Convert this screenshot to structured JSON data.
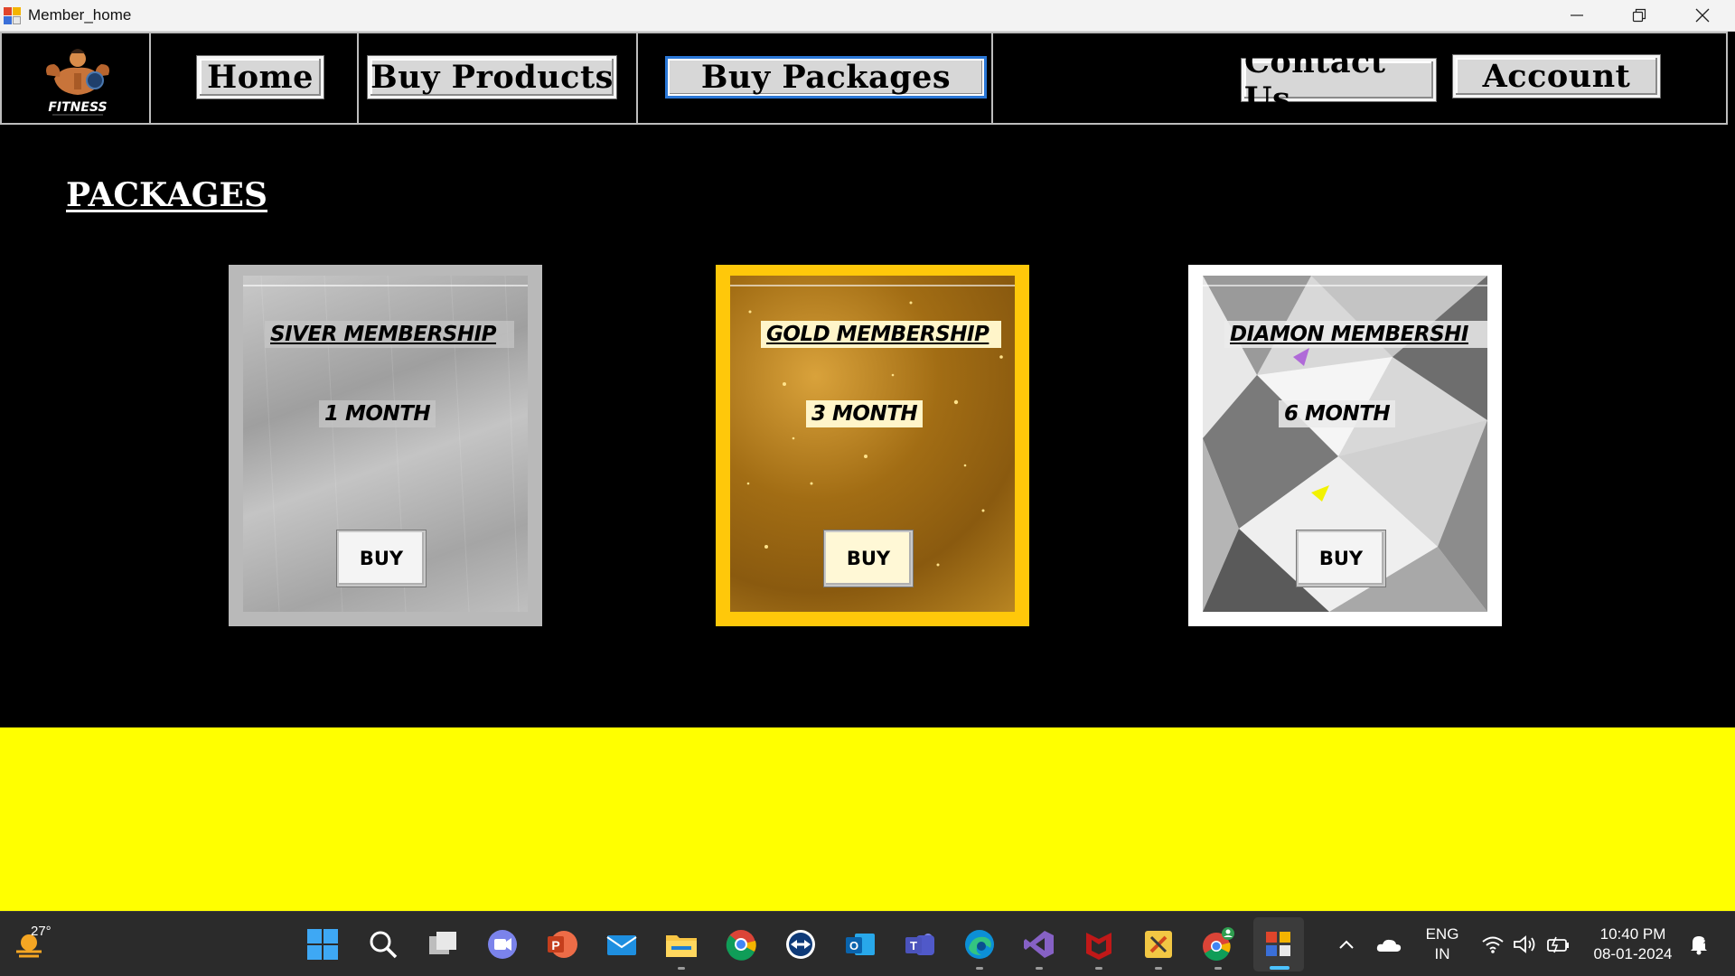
{
  "window": {
    "title": "Member_home",
    "controls": [
      "minimize",
      "restore",
      "close"
    ]
  },
  "nav": {
    "logo_text": "FITNESS",
    "home": "Home",
    "buy_products": "Buy Products",
    "buy_packages": "Buy Packages",
    "contact_us": "Contact Us",
    "account": "Account",
    "active": "Buy Packages"
  },
  "content": {
    "heading": "PACKAGES",
    "packages": [
      {
        "title": "SIVER MEMBERSHIP",
        "duration": "1 MONTH",
        "button": "BUY",
        "theme": "silver",
        "frame_color": "#b9b9b9"
      },
      {
        "title": "GOLD MEMBERSHIP",
        "duration": "3 MONTH",
        "button": "BUY",
        "theme": "gold",
        "frame_color": "#ffc80a"
      },
      {
        "title": "DIAMON MEMBERSHI",
        "duration": "6 MONTH",
        "button": "BUY",
        "theme": "diamond",
        "frame_color": "#ffffff"
      }
    ]
  },
  "footer_color": "#ffff00",
  "taskbar": {
    "weather_temp": "27°",
    "pinned_icons": [
      "windows-start-icon",
      "search-icon",
      "task-view-icon",
      "meet-chat-icon",
      "powerpoint-icon",
      "mail-icon",
      "file-explorer-icon",
      "chrome-icon",
      "teamviewer-icon",
      "outlook-icon",
      "teams-icon",
      "edge-icon",
      "visual-studio-icon",
      "mcafee-icon",
      "tools-app-icon",
      "chrome-profile-icon",
      "member-home-app-icon"
    ],
    "language": "ENG",
    "region": "IN",
    "time": "10:40 PM",
    "date": "08-01-2024"
  }
}
